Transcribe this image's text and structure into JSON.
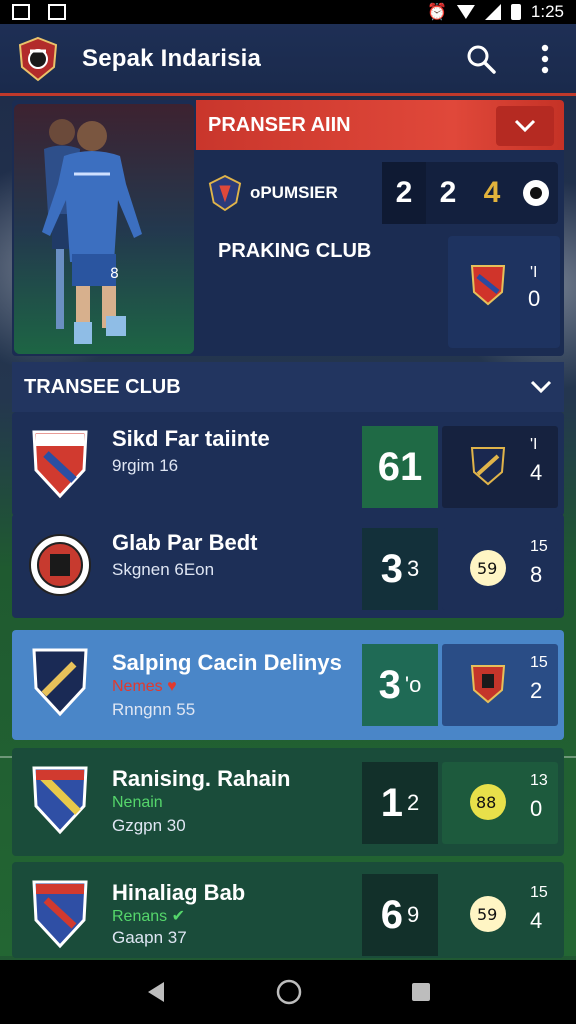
{
  "status_bar": {
    "time": "1:25"
  },
  "app_bar": {
    "title": "Sepak Indarisia"
  },
  "featured": {
    "header_title": "PRANSER AIIN",
    "competition_name": "oPUMSIER",
    "scores": [
      "2",
      "2",
      "4"
    ],
    "subtitle": "PRAKING CLUB",
    "side_values": [
      "'I",
      "0"
    ]
  },
  "section": {
    "title": "TRANSEE CLUB"
  },
  "rows": [
    {
      "name": "Sikd Far taiinte",
      "badge": "",
      "sub": "9rgim 16",
      "score_main": "61",
      "score_sec": "",
      "opp_top": "'I",
      "opp_bottom": "4",
      "theme": "navy"
    },
    {
      "name": "Glab Par Bedt",
      "badge": "",
      "sub": "Skgnen 6Eon",
      "score_main": "3",
      "score_sec": "3",
      "opp_top": "15",
      "opp_bottom": "8",
      "theme": "navy"
    },
    {
      "name": "Salping Cacin Delinys",
      "badge": "Nemes",
      "sub": "Rnngnn 55",
      "score_main": "3",
      "score_sec": "'o",
      "opp_top": "15",
      "opp_bottom": "2",
      "theme": "blue"
    },
    {
      "name": "Ranising. Rahain",
      "badge": "Nenain",
      "sub": "Gzgpn 30",
      "score_main": "1",
      "score_sec": "2",
      "opp_top": "13",
      "opp_bottom": "0",
      "theme": "green"
    },
    {
      "name": "Hinaliag Bab",
      "badge": "Renans",
      "sub": "Gaapn 37",
      "score_main": "6",
      "score_sec": "9",
      "opp_top": "15",
      "opp_bottom": "4",
      "theme": "green"
    }
  ],
  "colors": {
    "accent_red": "#d63a2f",
    "navy": "#1d2f57",
    "blue_row": "#4a86c8",
    "green_row": "#1a4c3a",
    "score_green": "#1f6a45"
  }
}
